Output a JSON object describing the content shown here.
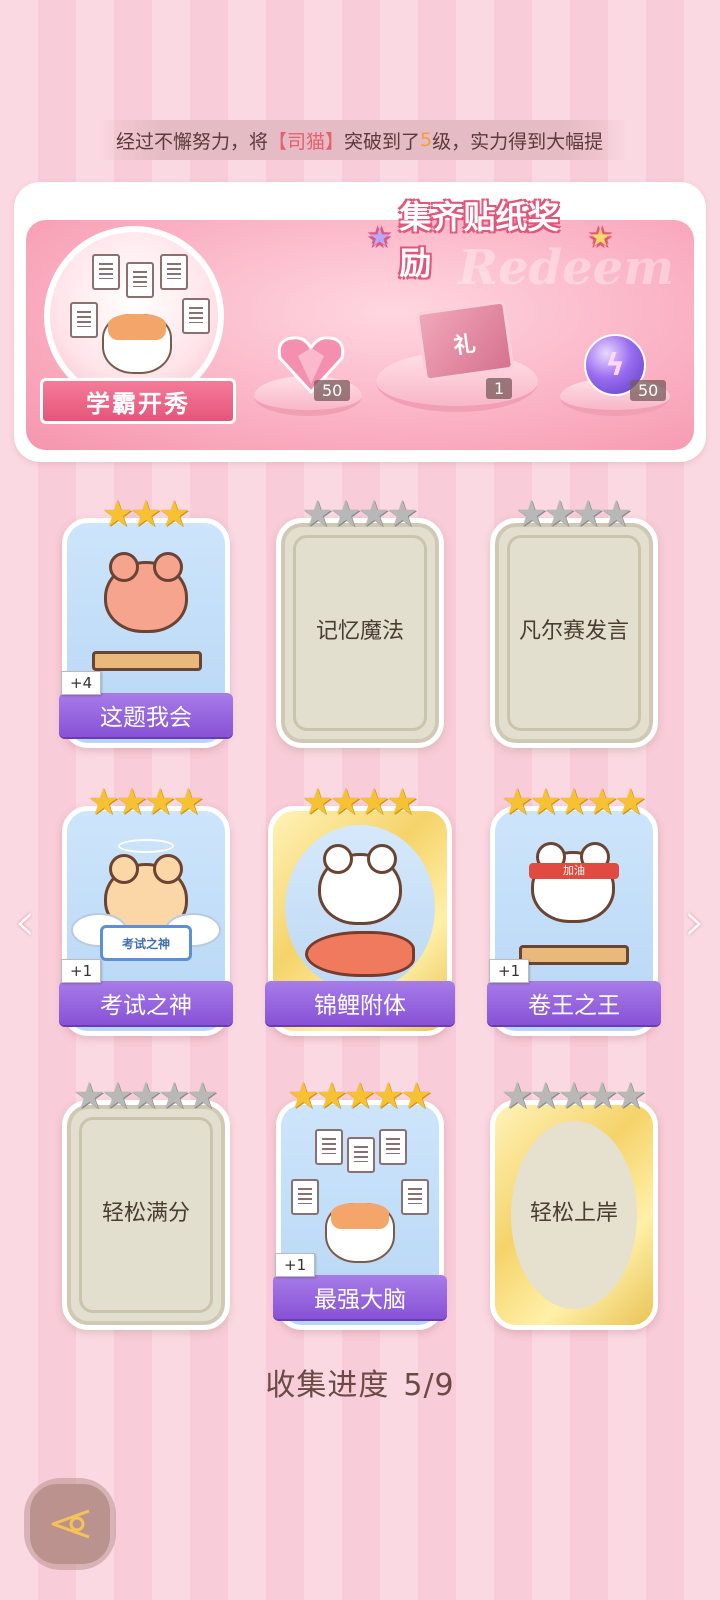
{
  "ticker": {
    "prefix": "经过不懈努力，将",
    "highlight": "【司猫】",
    "middle": "突破到了",
    "level": "5",
    "suffix": "级，实力得到大幅提"
  },
  "banner": {
    "title": "集齐贴纸奖励",
    "ghost_text": "Redeem",
    "badge_label": "学霸开秀",
    "rewards": [
      {
        "icon": "pink-heart-gem-icon",
        "count": "50"
      },
      {
        "icon": "gift-box-icon",
        "count": "1"
      },
      {
        "icon": "purple-energy-orb-icon",
        "count": "50"
      }
    ]
  },
  "cards": [
    {
      "name": "这题我会",
      "stars_filled": 3,
      "stars_total": 3,
      "unlocked": true,
      "plus": "+4",
      "art": "bear-at-desk"
    },
    {
      "name": "记忆魔法",
      "stars_filled": 0,
      "stars_total": 4,
      "unlocked": false
    },
    {
      "name": "凡尔赛发言",
      "stars_filled": 0,
      "stars_total": 4,
      "unlocked": false
    },
    {
      "name": "考试之神",
      "stars_filled": 4,
      "stars_total": 4,
      "unlocked": true,
      "plus": "+1",
      "art": "angel-cat",
      "sign_text": "考试之神"
    },
    {
      "name": "锦鲤附体",
      "stars_filled": 4,
      "stars_total": 4,
      "unlocked": true,
      "art": "bear-with-koi"
    },
    {
      "name": "卷王之王",
      "stars_filled": 5,
      "stars_total": 5,
      "unlocked": true,
      "plus": "+1",
      "art": "studying-cat",
      "headband_text": "加油"
    },
    {
      "name": "轻松满分",
      "stars_filled": 0,
      "stars_total": 5,
      "unlocked": false
    },
    {
      "name": "最强大脑",
      "stars_filled": 5,
      "stars_total": 5,
      "unlocked": true,
      "plus": "+1",
      "art": "cat-with-papers"
    },
    {
      "name": "轻松上岸",
      "stars_filled": 0,
      "stars_total": 5,
      "unlocked": false
    }
  ],
  "progress": {
    "label": "收集进度",
    "value": "5/9"
  },
  "colors": {
    "accent_pink": "#e4557a",
    "label_purple": "#8752d6",
    "star_gold": "#f6c234",
    "star_grey": "#b8b8b8"
  }
}
